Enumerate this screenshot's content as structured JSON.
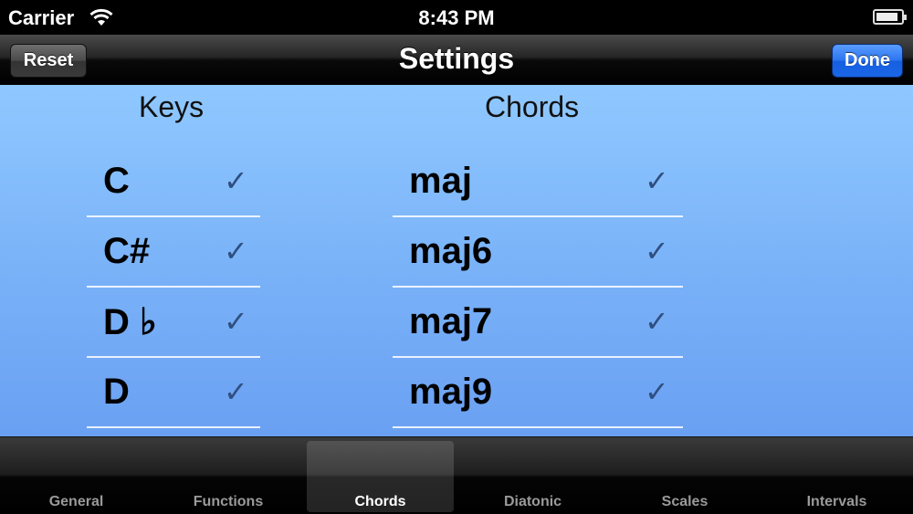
{
  "status_bar": {
    "carrier": "Carrier",
    "time": "8:43 PM",
    "battery_level": 0.9
  },
  "nav": {
    "title": "Settings",
    "reset_label": "Reset",
    "done_label": "Done"
  },
  "keys": {
    "header": "Keys",
    "items": [
      {
        "label": "C",
        "checked": true
      },
      {
        "label": "C#",
        "checked": true
      },
      {
        "label": "D ♭",
        "checked": true
      },
      {
        "label": "D",
        "checked": true
      }
    ]
  },
  "chords": {
    "header": "Chords",
    "items": [
      {
        "label": "maj",
        "checked": true
      },
      {
        "label": "maj6",
        "checked": true
      },
      {
        "label": "maj7",
        "checked": true
      },
      {
        "label": "maj9",
        "checked": true
      }
    ]
  },
  "check_glyph": "✓",
  "tabs": [
    {
      "label": "General",
      "selected": false
    },
    {
      "label": "Functions",
      "selected": false
    },
    {
      "label": "Chords",
      "selected": true
    },
    {
      "label": "Diatonic",
      "selected": false
    },
    {
      "label": "Scales",
      "selected": false
    },
    {
      "label": "Intervals",
      "selected": false
    }
  ],
  "colors": {
    "done_button": "#1a66e6",
    "content_background": "#79b1f8",
    "checkmark": "#2f4f80"
  }
}
